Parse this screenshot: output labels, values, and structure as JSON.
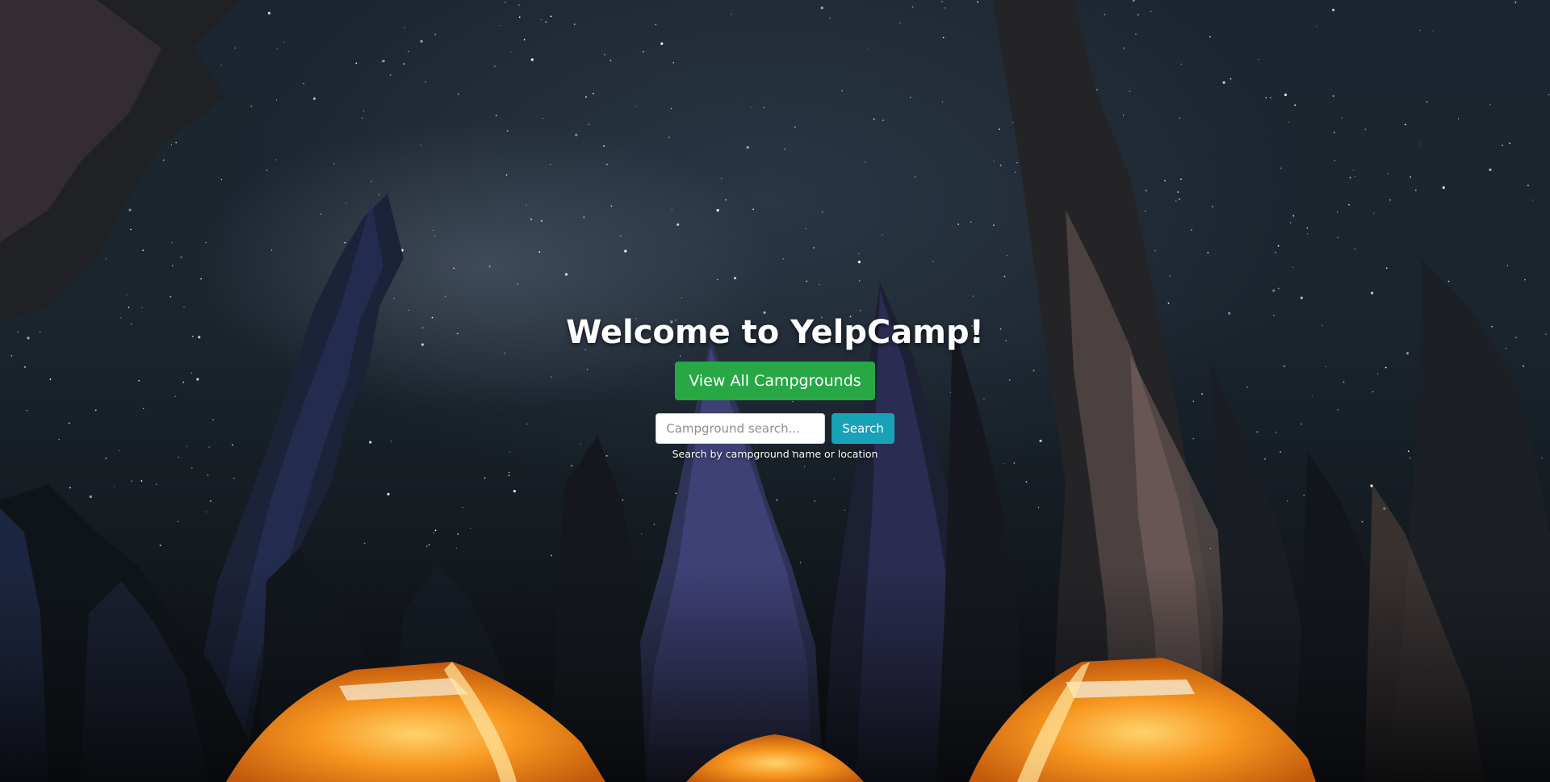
{
  "hero": {
    "title": "Welcome to YelpCamp!",
    "view_button_label": "View All Campgrounds",
    "search_placeholder": "Campground search...",
    "search_button_label": "Search",
    "search_help": "Search by campground name or location"
  },
  "background": {
    "scene": "night-sky-forest-tents",
    "sky_color": "#1b252e",
    "tent_color": "#f28a1a"
  },
  "colors": {
    "primary_success": "#28a745",
    "info": "#17a2b8",
    "text_light": "#ffffff"
  }
}
